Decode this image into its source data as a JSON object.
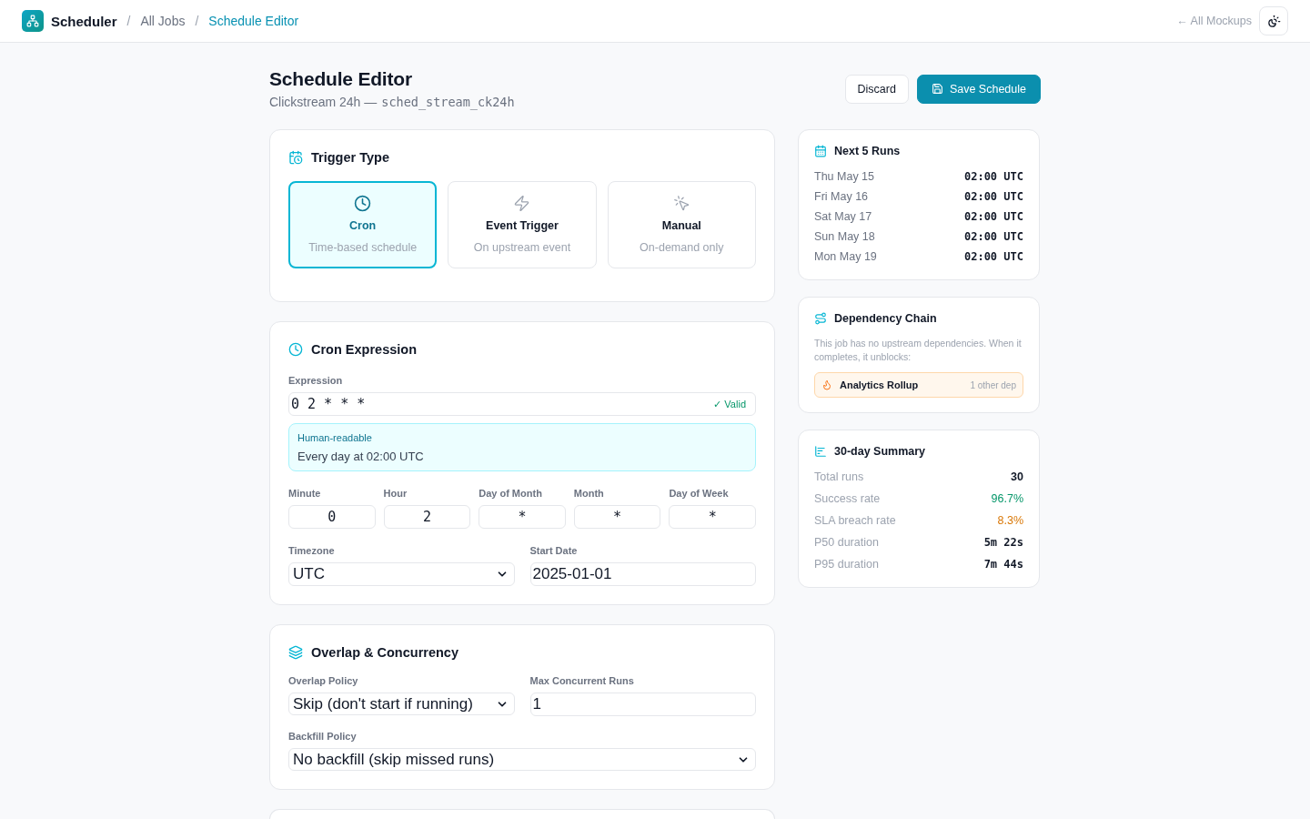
{
  "top_bar": {
    "app_name": "Scheduler",
    "breadcrumbs": [
      {
        "separator": "/",
        "label": "All Jobs",
        "selected": false
      },
      {
        "separator": "/",
        "label": "Schedule Editor",
        "selected": true
      }
    ],
    "back_link": "← All Mockups"
  },
  "header": {
    "title": "Schedule Editor",
    "job_name": "Clickstream 24h —",
    "job_id": "sched_stream_ck24h",
    "buttons": [
      {
        "label": "Discard",
        "kind": "secondary"
      },
      {
        "label": "Save Schedule",
        "kind": "primary"
      }
    ]
  },
  "trigger_type": {
    "title": "Trigger Type",
    "options": [
      {
        "kind": "cron",
        "label": "Cron",
        "description": "Time-based schedule",
        "selected": true
      },
      {
        "kind": "event",
        "label": "Event Trigger",
        "description": "On upstream event",
        "selected": false
      },
      {
        "kind": "manual",
        "label": "Manual",
        "description": "On-demand only",
        "selected": false
      }
    ]
  },
  "cron_expression": {
    "title": "Cron Expression",
    "expression": {
      "label": "Expression",
      "value": "0 2 * * *",
      "status": "✓ Valid",
      "valid": true
    },
    "human_readable": {
      "label": "Human-readable",
      "text": "Every day at 02:00 UTC"
    },
    "fields": [
      {
        "label": "Minute",
        "value": "0"
      },
      {
        "label": "Hour",
        "value": "2"
      },
      {
        "label": "Day of Month",
        "value": "*"
      },
      {
        "label": "Month",
        "value": "*"
      },
      {
        "label": "Day of Week",
        "value": "*"
      }
    ],
    "timezone": {
      "label": "Timezone",
      "value": "UTC"
    },
    "start_date": {
      "label": "Start Date",
      "value": "2025-01-01"
    }
  },
  "overlap_concurrency": {
    "title": "Overlap & Concurrency",
    "overlap_policy": {
      "label": "Overlap Policy",
      "value": "Skip (don't start if running)"
    },
    "max_concurrent_runs": {
      "label": "Max Concurrent Runs",
      "value": "1"
    },
    "backfill_policy": {
      "label": "Backfill Policy",
      "value": "No backfill (skip missed runs)"
    }
  },
  "next_runs": {
    "title": "Next 5 Runs",
    "runs": [
      {
        "date": "Thu May 15",
        "time": "02:00 UTC"
      },
      {
        "date": "Fri May 16",
        "time": "02:00 UTC"
      },
      {
        "date": "Sat May 17",
        "time": "02:00 UTC"
      },
      {
        "date": "Sun May 18",
        "time": "02:00 UTC"
      },
      {
        "date": "Mon May 19",
        "time": "02:00 UTC"
      }
    ]
  },
  "dependency_chain": {
    "title": "Dependency Chain",
    "description": "This job has no upstream dependencies. When it completes, it unblocks:",
    "dependents": [
      {
        "name": "Analytics Rollup",
        "note": "1 other dep"
      }
    ]
  },
  "summary": {
    "title": "30-day Summary",
    "stats": [
      {
        "label": "Total runs",
        "value": "30",
        "kind": "count"
      },
      {
        "label": "Success rate",
        "value": "96.7%",
        "kind": "good"
      },
      {
        "label": "SLA breach rate",
        "value": "8.3%",
        "kind": "warn"
      },
      {
        "label": "P50 duration",
        "value": "5m 22s",
        "kind": "duration"
      },
      {
        "label": "P95 duration",
        "value": "7m 44s",
        "kind": "duration"
      }
    ]
  }
}
